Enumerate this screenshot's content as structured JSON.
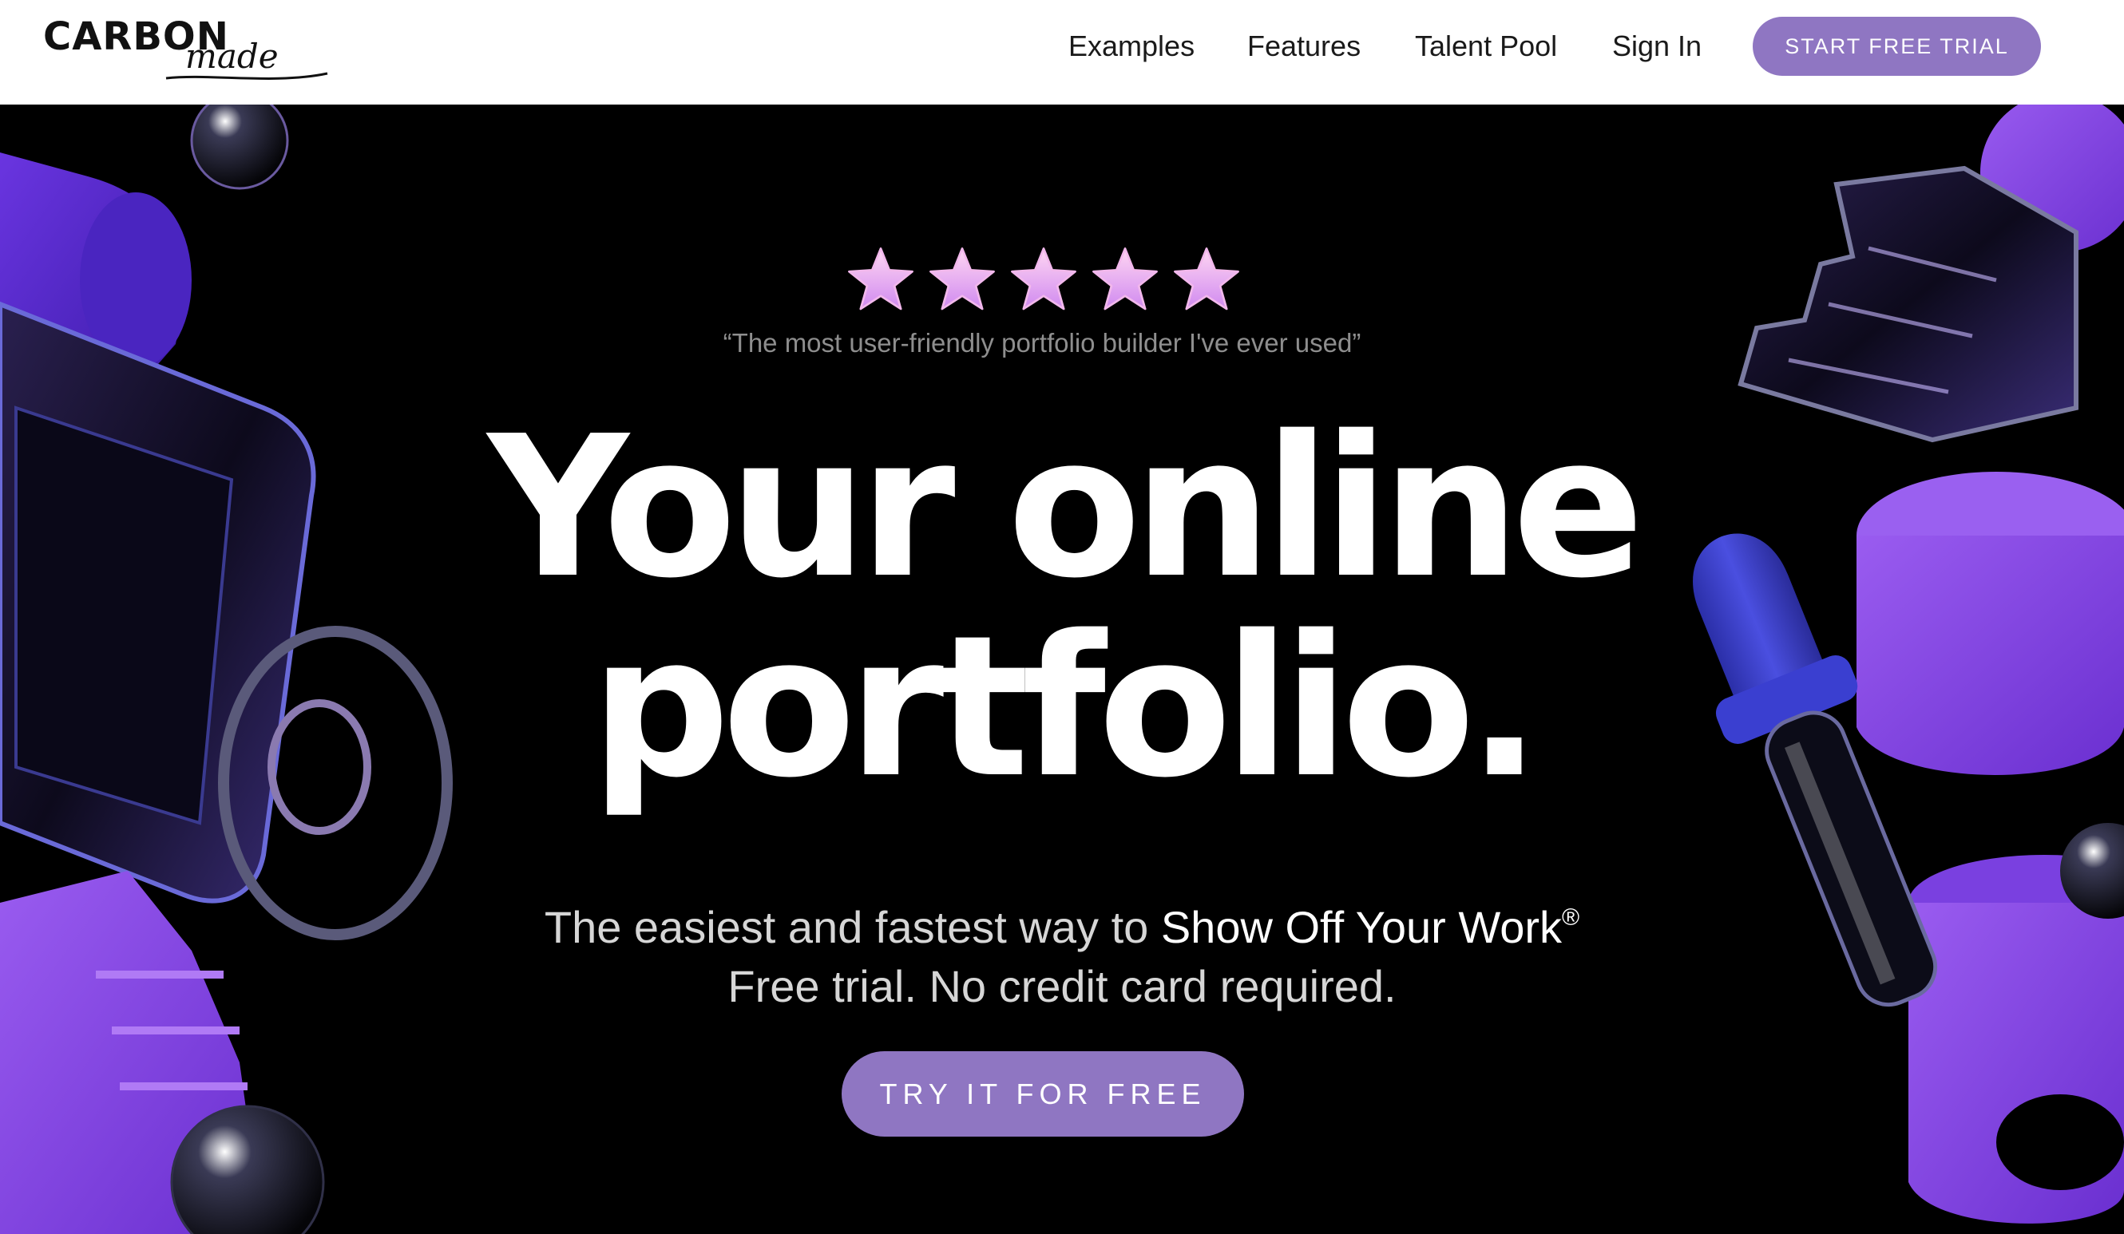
{
  "brand": {
    "name": "CARBON",
    "script": "made",
    "accent": "#8f76c2"
  },
  "nav": {
    "links": [
      "Examples",
      "Features",
      "Talent Pool",
      "Sign In"
    ],
    "cta": "START FREE TRIAL"
  },
  "hero": {
    "rating": 5,
    "rating_icon": "star-icon",
    "quote": "“The most user-friendly portfolio builder I've ever used”",
    "headline": [
      "Your online",
      "portfolio."
    ],
    "tagline_lead": "The easiest and fastest way to ",
    "tagline_emphasis": "Show Off Your Work",
    "tagline_mark": "®",
    "subline": "Free trial. No credit card required.",
    "cta": "TRY IT FOR FREE"
  }
}
